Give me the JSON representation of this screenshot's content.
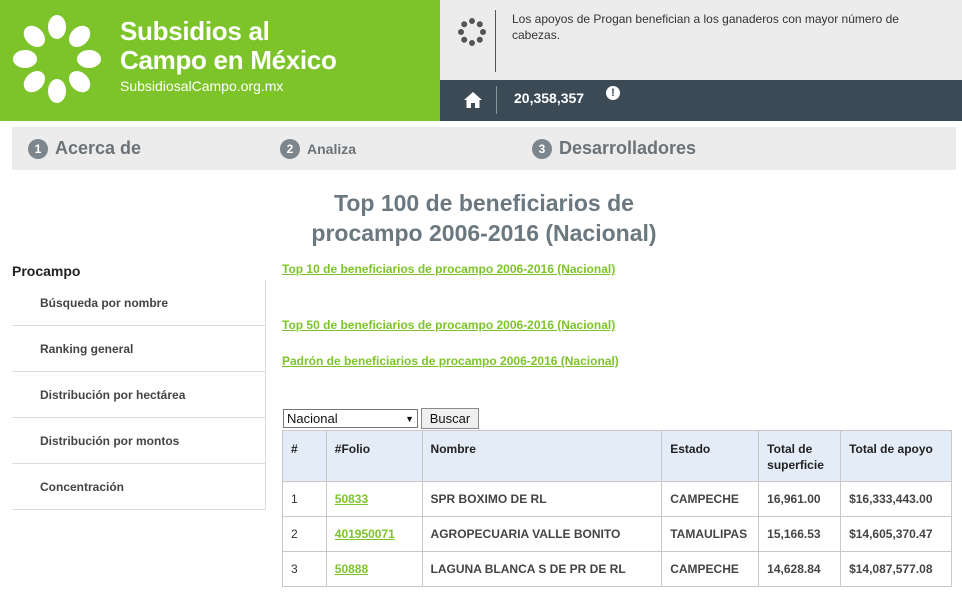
{
  "brand": {
    "title_line1": "Subsidios al",
    "title_line2": "Campo en México",
    "url": "SubsidiosalCampo.org.mx",
    "color": "#7cc42a"
  },
  "fact": {
    "icon": "spinner-icon",
    "text": "Los apoyos de Progan benefician a los ganaderos con mayor número de cabezas."
  },
  "stat_bar": {
    "home_icon": "home-icon",
    "value": "20,358,357",
    "alert_icon": "!"
  },
  "nav": [
    {
      "num": "1",
      "label": "Acerca de"
    },
    {
      "num": "2",
      "label": "Analiza"
    },
    {
      "num": "3",
      "label": "Desarrolladores"
    }
  ],
  "page_title": {
    "line1": "Top 100 de beneficiarios de",
    "line2": "procampo 2006-2016 (Nacional)"
  },
  "sidebar": {
    "heading": "Procampo",
    "items": [
      "Búsqueda por nombre",
      "Ranking general",
      "Distribución por hectárea",
      "Distribución por montos",
      "Concentración"
    ]
  },
  "links": [
    "Top 10 de beneficiarios de procampo 2006-2016 (Nacional)",
    "Top 50 de beneficiarios de procampo 2006-2016 (Nacional)",
    "Padrón de beneficiarios de procampo 2006-2016 (Nacional)"
  ],
  "filter": {
    "selected": "Nacional",
    "button": "Buscar"
  },
  "table": {
    "headers": [
      "#",
      "#Folio",
      "Nombre",
      "Estado",
      "Total de superficie",
      "Total de apoyo"
    ],
    "rows": [
      [
        "1",
        "50833",
        "SPR BOXIMO DE RL",
        "CAMPECHE",
        "16,961.00",
        "$16,333,443.00"
      ],
      [
        "2",
        "401950071",
        "AGROPECUARIA VALLE BONITO",
        "TAMAULIPAS",
        "15,166.53",
        "$14,605,370.47"
      ],
      [
        "3",
        "50888",
        "LAGUNA BLANCA S DE PR DE RL",
        "CAMPECHE",
        "14,628.84",
        "$14,087,577.08"
      ]
    ]
  }
}
